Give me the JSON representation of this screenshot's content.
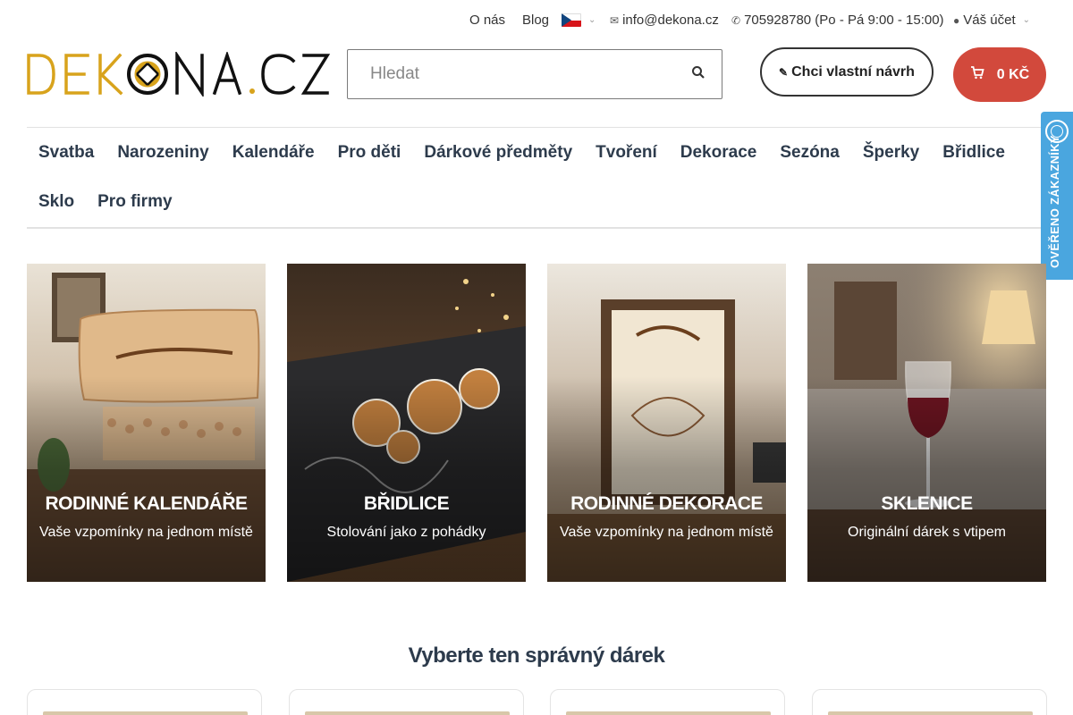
{
  "topbar": {
    "about": "O nás",
    "blog": "Blog",
    "email": "info@dekona.cz",
    "phone": "705928780 (Po - Pá 9:00 - 15:00)",
    "account": "Váš účet"
  },
  "logo": {
    "text": "DEKONA.CZ",
    "accent_color": "#d8a31c"
  },
  "search": {
    "placeholder": "Hledat"
  },
  "design_button": {
    "label": "Chci vlastní návrh"
  },
  "cart": {
    "label": "0 KČ",
    "color": "#d2493c"
  },
  "nav": {
    "row1": [
      "Svatba",
      "Narozeniny",
      "Kalendáře",
      "Pro děti",
      "Dárkové předměty",
      "Tvoření",
      "Dekorace",
      "Sezóna",
      "Šperky",
      "Břidlice"
    ],
    "row2": [
      "Sklo",
      "Pro firmy"
    ]
  },
  "trust_badge": {
    "label": "OVĚŘENO ZÁKAZNÍKY",
    "color": "#4aa6df"
  },
  "cards": [
    {
      "title": "Rodinné kalendáře",
      "subtitle": "Vaše vzpomínky na jednom místě"
    },
    {
      "title": "Břidlice",
      "subtitle": "Stolování jako z pohádky"
    },
    {
      "title": "Rodinné dekorace",
      "subtitle": "Vaše vzpomínky na jednom místě"
    },
    {
      "title": "Sklenice",
      "subtitle": "Originální dárek s vtipem"
    }
  ],
  "section": {
    "title": "Vyberte ten správný dárek"
  }
}
